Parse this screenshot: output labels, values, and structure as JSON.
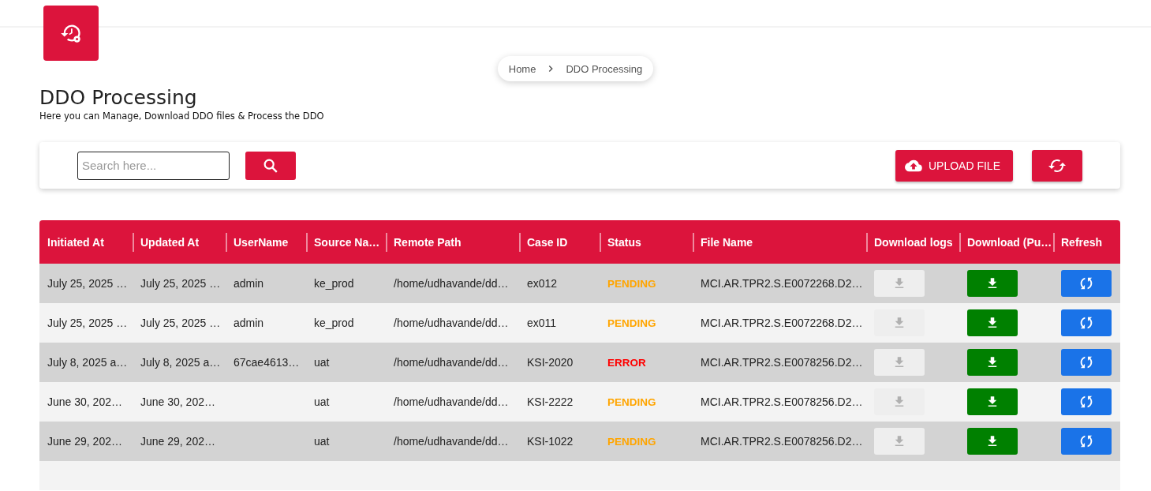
{
  "breadcrumb": [
    {
      "label": "Home"
    },
    {
      "label": "DDO Processing"
    }
  ],
  "page": {
    "title": "DDO Processing",
    "subtitle": "Here you can Manage, Download DDO files & Process the DDO"
  },
  "toolbar": {
    "search": {
      "placeholder": "Search here..."
    },
    "upload_button": "UPLOAD FILE"
  },
  "table": {
    "columns": [
      "Initiated At",
      "Updated At",
      "UserName",
      "Source Na…",
      "Remote Path",
      "Case ID",
      "Status",
      "File Name",
      "Download logs",
      "Download (Pu…",
      "Refresh"
    ],
    "rows": [
      {
        "initiated": "July 25, 2025 …",
        "updated": "July 25, 2025 …",
        "user": "admin",
        "source": "ke_prod",
        "path": "/home/udhavande/dd…",
        "case": "ex012",
        "status": {
          "text": "PENDING",
          "kind": "pending"
        },
        "file": "MCI.AR.TPR2.S.E0072268.D2…",
        "logs_disabled": true
      },
      {
        "initiated": "July 25, 2025 …",
        "updated": "July 25, 2025 …",
        "user": "admin",
        "source": "ke_prod",
        "path": "/home/udhavande/dd…",
        "case": "ex011",
        "status": {
          "text": "PENDING",
          "kind": "pending"
        },
        "file": "MCI.AR.TPR2.S.E0072268.D2…",
        "logs_disabled": true
      },
      {
        "initiated": "July 8, 2025 a…",
        "updated": "July 8, 2025 a…",
        "user": "67cae4613…",
        "source": "uat",
        "path": "/home/udhavande/dd…",
        "case": "KSI-2020",
        "status": {
          "text": "ERROR",
          "kind": "error"
        },
        "file": "MCI.AR.TPR2.S.E0078256.D2…",
        "logs_disabled": true
      },
      {
        "initiated": "June 30, 202…",
        "updated": "June 30, 202…",
        "source": "uat",
        "path": "/home/udhavande/dd…",
        "case": "KSI-2222",
        "status": {
          "text": "PENDING",
          "kind": "pending"
        },
        "file": "MCI.AR.TPR2.S.E0078256.D2…",
        "logs_disabled": true
      },
      {
        "initiated": "June 29, 202…",
        "updated": "June 29, 202…",
        "source": "uat",
        "path": "/home/udhavande/dd…",
        "case": "KSI-1022",
        "status": {
          "text": "PENDING",
          "kind": "pending"
        },
        "file": "MCI.AR.TPR2.S.E0078256.D2…",
        "logs_disabled": true
      }
    ]
  }
}
